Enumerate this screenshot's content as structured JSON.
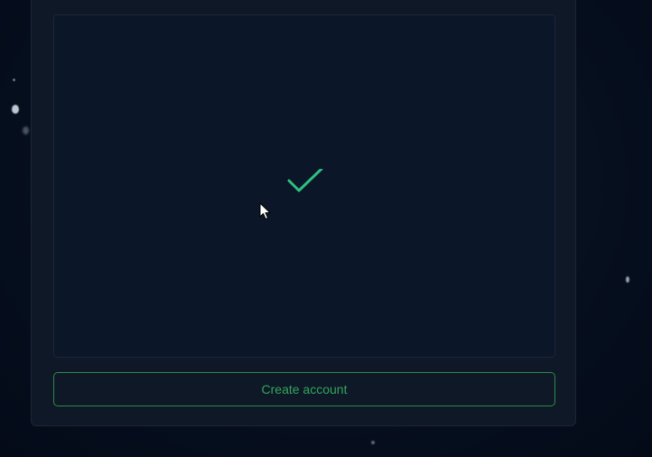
{
  "signup": {
    "create_button_label": "Create account"
  },
  "status": {
    "icon": "checkmark-icon",
    "color": "#2fbf7f"
  },
  "colors": {
    "background": "#050c1c",
    "panel": "#0e1827",
    "frame": "#0b1629",
    "button_border": "#2d8a4a",
    "button_text": "#33a65d"
  }
}
